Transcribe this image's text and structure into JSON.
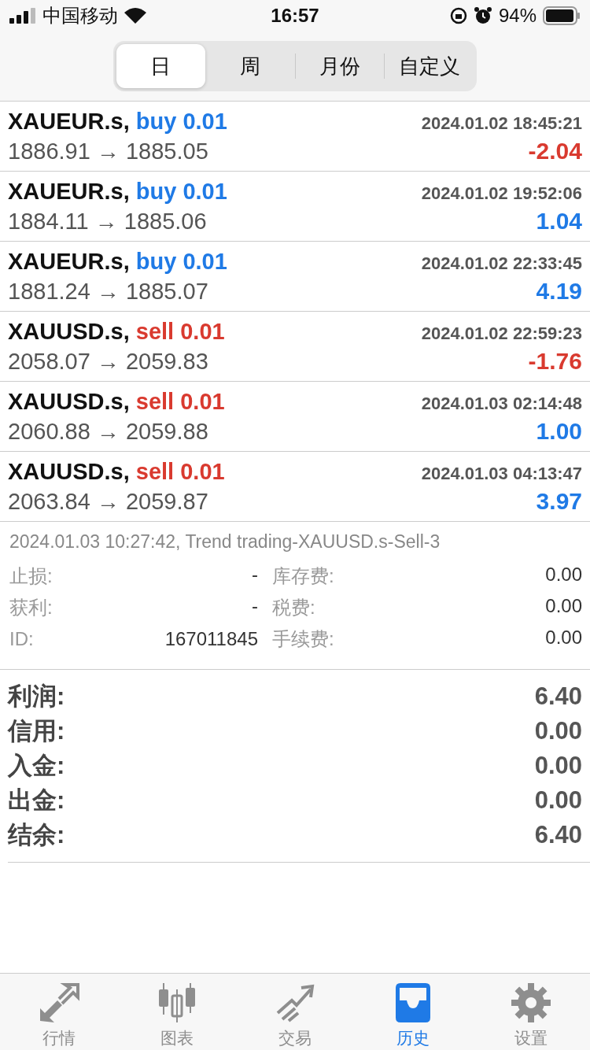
{
  "status_bar": {
    "carrier": "中国移动",
    "time": "16:57",
    "battery": "94%"
  },
  "periods": [
    {
      "label": "日",
      "selected": true
    },
    {
      "label": "周",
      "selected": false
    },
    {
      "label": "月份",
      "selected": false
    },
    {
      "label": "自定义",
      "selected": false
    }
  ],
  "deals": [
    {
      "symbol": "XAUEUR.s,",
      "order": {
        "text": "buy 0.01",
        "kind": "buy"
      },
      "time": "2024.01.02 18:45:21",
      "prices": "1886.91 → 1885.05",
      "profit": {
        "text": "-2.04",
        "kind": "loss"
      }
    },
    {
      "symbol": "XAUEUR.s,",
      "order": {
        "text": "buy 0.01",
        "kind": "buy"
      },
      "time": "2024.01.02 19:52:06",
      "prices": "1884.11 → 1885.06",
      "profit": {
        "text": "1.04",
        "kind": "gain"
      }
    },
    {
      "symbol": "XAUEUR.s,",
      "order": {
        "text": "buy 0.01",
        "kind": "buy"
      },
      "time": "2024.01.02 22:33:45",
      "prices": "1881.24 → 1885.07",
      "profit": {
        "text": "4.19",
        "kind": "gain"
      }
    },
    {
      "symbol": "XAUUSD.s,",
      "order": {
        "text": "sell 0.01",
        "kind": "sell"
      },
      "time": "2024.01.02 22:59:23",
      "prices": "2058.07 → 2059.83",
      "profit": {
        "text": "-1.76",
        "kind": "loss"
      }
    },
    {
      "symbol": "XAUUSD.s,",
      "order": {
        "text": "sell 0.01",
        "kind": "sell"
      },
      "time": "2024.01.03 02:14:48",
      "prices": "2060.88 → 2059.88",
      "profit": {
        "text": "1.00",
        "kind": "gain"
      }
    },
    {
      "symbol": "XAUUSD.s,",
      "order": {
        "text": "sell 0.01",
        "kind": "sell"
      },
      "time": "2024.01.03 04:13:47",
      "prices": "2063.84 → 2059.87",
      "profit": {
        "text": "3.97",
        "kind": "gain"
      }
    }
  ],
  "detail": {
    "comment": "2024.01.03 10:27:42, Trend trading-XAUUSD.s-Sell-3",
    "fields": [
      {
        "label": "止损:",
        "value": "-",
        "label2": "库存费:",
        "value2": "0.00"
      },
      {
        "label": "获利:",
        "value": "-",
        "label2": "税费:",
        "value2": "0.00"
      },
      {
        "label": "ID:",
        "value": "167011845",
        "label2": "手续费:",
        "value2": "0.00"
      }
    ]
  },
  "summary": [
    {
      "label": "利润:",
      "value": "6.40"
    },
    {
      "label": "信用:",
      "value": "0.00"
    },
    {
      "label": "入金:",
      "value": "0.00"
    },
    {
      "label": "出金:",
      "value": "0.00"
    },
    {
      "label": "结余:",
      "value": "6.40"
    }
  ],
  "tab_bar": [
    {
      "label": "行情",
      "selected": false
    },
    {
      "label": "图表",
      "selected": false
    },
    {
      "label": "交易",
      "selected": false
    },
    {
      "label": "历史",
      "selected": true
    },
    {
      "label": "设置",
      "selected": false
    }
  ]
}
